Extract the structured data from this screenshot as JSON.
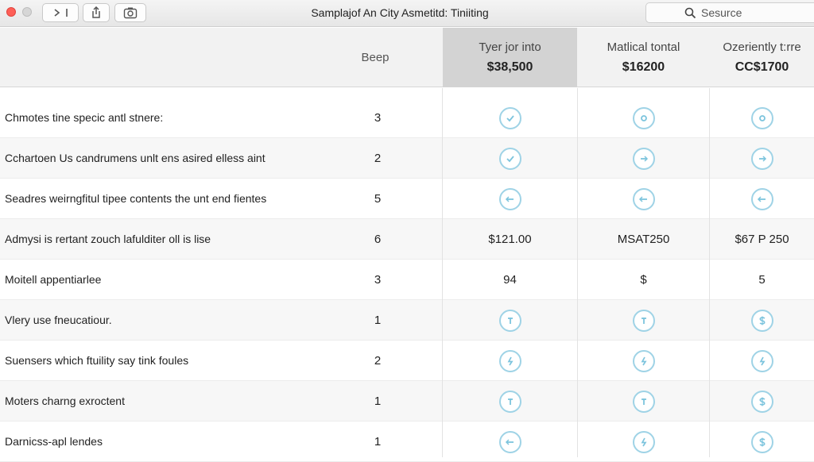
{
  "window": {
    "title": "Samplajof An City Asmetitd: Tiniiting",
    "search_placeholder": "Sesurce"
  },
  "colors": {
    "accent": "#9fd3e6",
    "header_bg": "#f2f2f2",
    "highlight_col": "#d3d3d3",
    "close_red": "#fe5f57"
  },
  "table": {
    "beep_header": "Beep",
    "plans": [
      {
        "name": "Tyer jor into",
        "price": "$38,500"
      },
      {
        "name": "Matlical tontal",
        "price": "$16200"
      },
      {
        "name": "Ozeriently t:rre",
        "price": "CC$1700"
      }
    ],
    "rows": [
      {
        "feature": "Chmotes tine specic antl stnere:",
        "count": "3",
        "cells": [
          {
            "type": "icon",
            "icon": "check-circle-icon"
          },
          {
            "type": "icon",
            "icon": "info-circle-icon"
          },
          {
            "type": "icon",
            "icon": "info-circle-icon"
          }
        ]
      },
      {
        "feature": "Cchartoen Us candrumens unlt ens asired elless aint",
        "count": "2",
        "cells": [
          {
            "type": "icon",
            "icon": "check-circle-icon"
          },
          {
            "type": "icon",
            "icon": "dash-circle-icon"
          },
          {
            "type": "icon",
            "icon": "dash-circle-icon"
          }
        ]
      },
      {
        "feature": "Seadres weirngfitul tipee contents the unt end fientes",
        "count": "5",
        "cells": [
          {
            "type": "icon",
            "icon": "arrow-circle-icon"
          },
          {
            "type": "icon",
            "icon": "arrow-circle-icon"
          },
          {
            "type": "icon",
            "icon": "arrow-circle-icon"
          }
        ]
      },
      {
        "feature": "Admysi is rertant zouch lafulditer oll is lise",
        "count": "6",
        "cells": [
          {
            "type": "text",
            "value": "$121.00"
          },
          {
            "type": "text",
            "value": "MSAT250"
          },
          {
            "type": "text",
            "value": "$67 P 250"
          }
        ]
      },
      {
        "feature": "Moitell appentiarlee",
        "count": "3",
        "cells": [
          {
            "type": "text",
            "value": "94"
          },
          {
            "type": "text",
            "value": "$"
          },
          {
            "type": "text",
            "value": "5"
          }
        ]
      },
      {
        "feature": "Vlery use fneucatiour.",
        "count": "1",
        "cells": [
          {
            "type": "icon",
            "icon": "pin-circle-icon"
          },
          {
            "type": "icon",
            "icon": "pin-circle-icon"
          },
          {
            "type": "icon",
            "icon": "dollar-circle-icon"
          }
        ]
      },
      {
        "feature": "Suensers which ftuility say tink foules",
        "count": "2",
        "cells": [
          {
            "type": "icon",
            "icon": "bolt-circle-icon"
          },
          {
            "type": "icon",
            "icon": "bolt-circle-icon"
          },
          {
            "type": "icon",
            "icon": "bolt-circle-icon"
          }
        ]
      },
      {
        "feature": "Moters charng exroctent",
        "count": "1",
        "cells": [
          {
            "type": "icon",
            "icon": "pin-circle-icon"
          },
          {
            "type": "icon",
            "icon": "pin-circle-icon"
          },
          {
            "type": "icon",
            "icon": "dollar-circle-icon"
          }
        ]
      },
      {
        "feature": "Darnicss-apl lendes",
        "count": "1",
        "cells": [
          {
            "type": "icon",
            "icon": "arrow-circle-icon"
          },
          {
            "type": "icon",
            "icon": "bolt-circle-icon"
          },
          {
            "type": "icon",
            "icon": "dollar-circle-icon"
          }
        ]
      }
    ]
  }
}
